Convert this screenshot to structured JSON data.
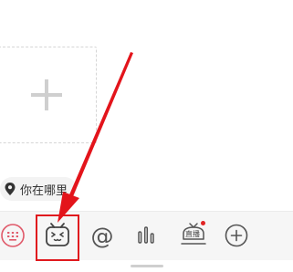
{
  "location": {
    "label": "你在哪里",
    "icon": "location-pin-icon"
  },
  "toolbar": {
    "items": [
      {
        "name": "keyboard-icon"
      },
      {
        "name": "emoji-icon",
        "selected": true
      },
      {
        "name": "mention-icon",
        "label": "@"
      },
      {
        "name": "voice-icon"
      },
      {
        "name": "live-icon",
        "label": "直播",
        "badge": true
      },
      {
        "name": "add-icon"
      }
    ]
  },
  "colors": {
    "accent": "#e0191e",
    "badge": "#e02424",
    "keyboard": "#e05a6a",
    "icon": "#555555"
  }
}
